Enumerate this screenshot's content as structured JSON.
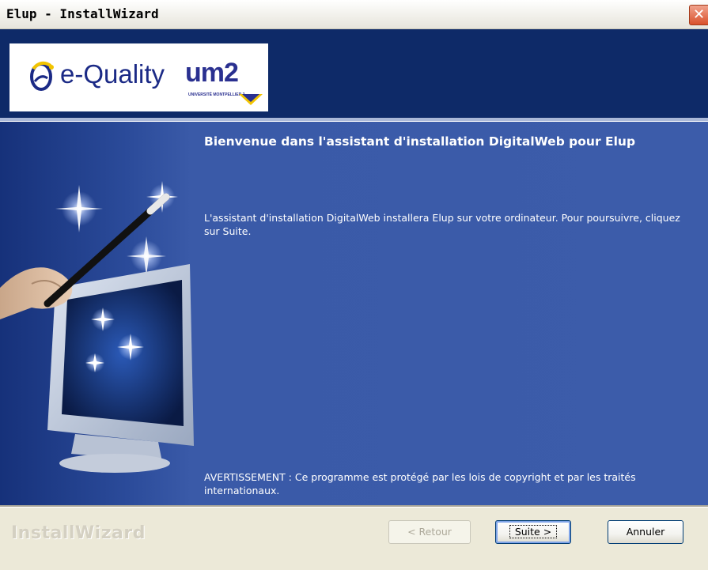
{
  "window": {
    "title": "Elup - InstallWizard",
    "close_glyph": "✕"
  },
  "header": {
    "logo_eq": "e-Quality",
    "logo_um2": "um2",
    "logo_um2_sub": "UNIVERSITÉ MONTPELLIER 2"
  },
  "content": {
    "welcome": "Bienvenue dans l'assistant d'installation DigitalWeb pour Elup",
    "description": "L'assistant d'installation DigitalWeb installera Elup sur votre ordinateur. Pour poursuivre, cliquez sur Suite.",
    "warning": "AVERTISSEMENT : Ce programme est protégé par les lois de copyright et par les traités internationaux."
  },
  "footer": {
    "brand": "InstallWizard",
    "back_label": "< Retour",
    "next_label": "Suite >",
    "cancel_label": "Annuler"
  },
  "icons": {
    "close": "close-icon",
    "wizard": "magic-wand-monitor-illustration"
  },
  "colors": {
    "header_bg": "#0e2a68",
    "panel_bg": "#3c5caa",
    "titlebar_close": "#d9512c"
  }
}
